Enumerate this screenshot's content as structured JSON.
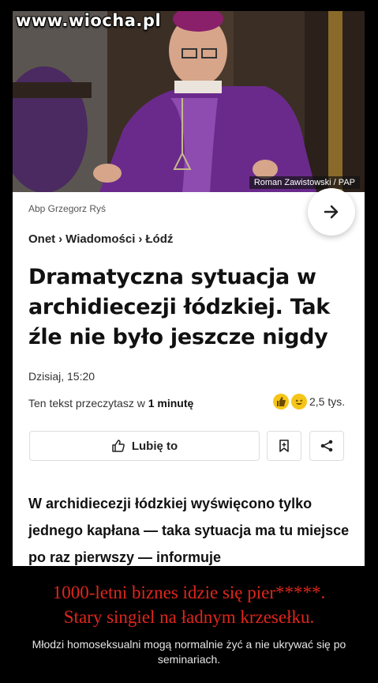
{
  "watermark": "www.wiocha.pl",
  "photo": {
    "credit": "Roman Zawistowski / PAP",
    "caption": "Abp Grzegorz Ryś"
  },
  "breadcrumb": {
    "items": [
      "Onet",
      "Wiadomości",
      "Łódź"
    ],
    "separator": "›"
  },
  "article": {
    "title": "Dramatyczna sytuacja w archidiecezji łódzkiej. Tak źle nie było jeszcze nigdy",
    "date": "Dzisiaj, 15:20",
    "read_time_prefix": "Ten tekst przeczytasz w",
    "read_time_value": "1 minutę",
    "reactions_count": "2,5 tys.",
    "like_label": "Lubię to",
    "lead": "W archidiecezji łódzkiej wyświęcono tylko jednego kapłana — taka sytuacja ma tu miejsce po raz pierwszy — informuje"
  },
  "demotivator": {
    "headline_line1": "1000-letni biznes idzie się pier*****.",
    "headline_line2": "Stary singiel na ładnym krzesełku.",
    "subtext": "Młodzi homoseksualni mogą normalnie żyć a nie ukrywać się po seminariach."
  },
  "colors": {
    "headline": "#e0261c",
    "vestment": "#6a2a8c",
    "background": "#000000"
  }
}
